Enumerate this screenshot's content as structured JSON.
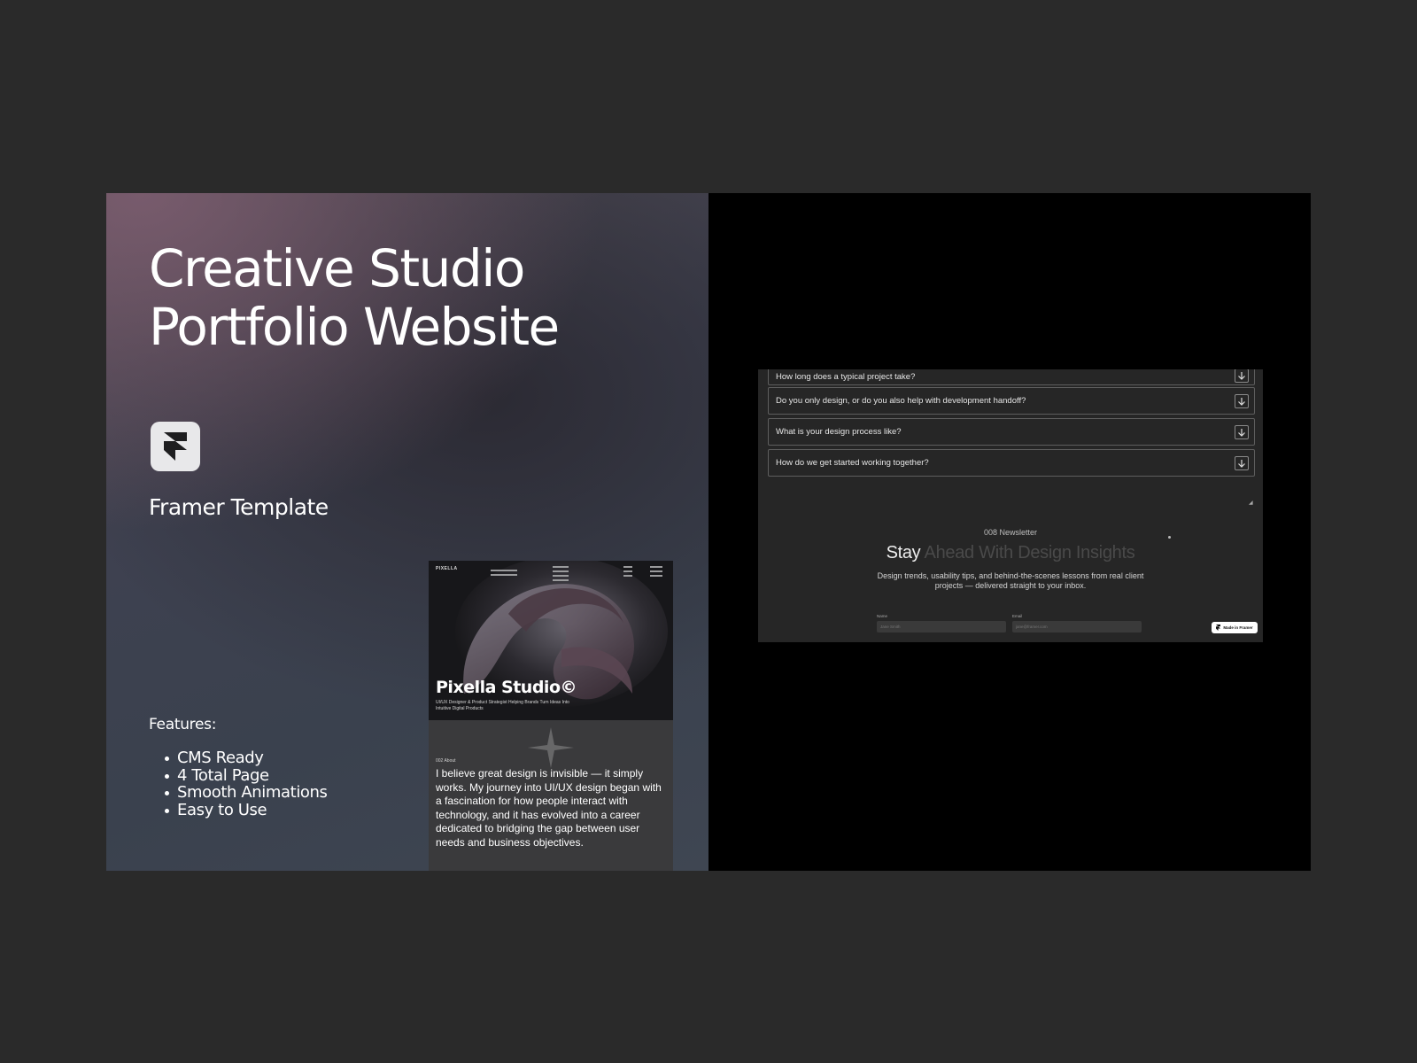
{
  "promo": {
    "title_line1": "Creative Studio",
    "title_line2": "Portfolio Website",
    "template_label": "Framer Template",
    "features_heading": "Features:",
    "features": [
      "CMS Ready",
      "4 Total Page",
      "Smooth Animations",
      "Easy to Use"
    ]
  },
  "mockup": {
    "brand": "PIXELLA",
    "title": "Pixella Studio©",
    "subtitle": "UI/UX Designer & Product Strategist Helping Brands Turn Ideas Into Intuitive Digital Products",
    "about_label": "002 About",
    "about_text": "I believe great design is invisible — it simply works. My journey into UI/UX design began with a fascination for how people interact with technology, and it has evolved into a career dedicated to bridging the gap between user needs and business objectives."
  },
  "website": {
    "faq": [
      {
        "question": "How long does a typical project take?"
      },
      {
        "question": "Do you only design, or do you also help with development handoff?"
      },
      {
        "question": "What is your design process like?"
      },
      {
        "question": "How do we get started working together?"
      }
    ],
    "newsletter": {
      "label": "008 Newsletter",
      "title_visible": "Stay",
      "title_faded": " Ahead With Design Insights",
      "description": "Design trends, usability tips, and behind-the-scenes lessons from real client projects — delivered straight to your inbox.",
      "name_label": "Name",
      "name_placeholder": "Jane Smith",
      "email_label": "Email",
      "email_placeholder": "jane@framer.com",
      "badge": "Made in Framer"
    }
  },
  "colors": {
    "page_bg": "#2a2a2a",
    "dark_panel": "#000000",
    "site_bg": "#262626"
  }
}
